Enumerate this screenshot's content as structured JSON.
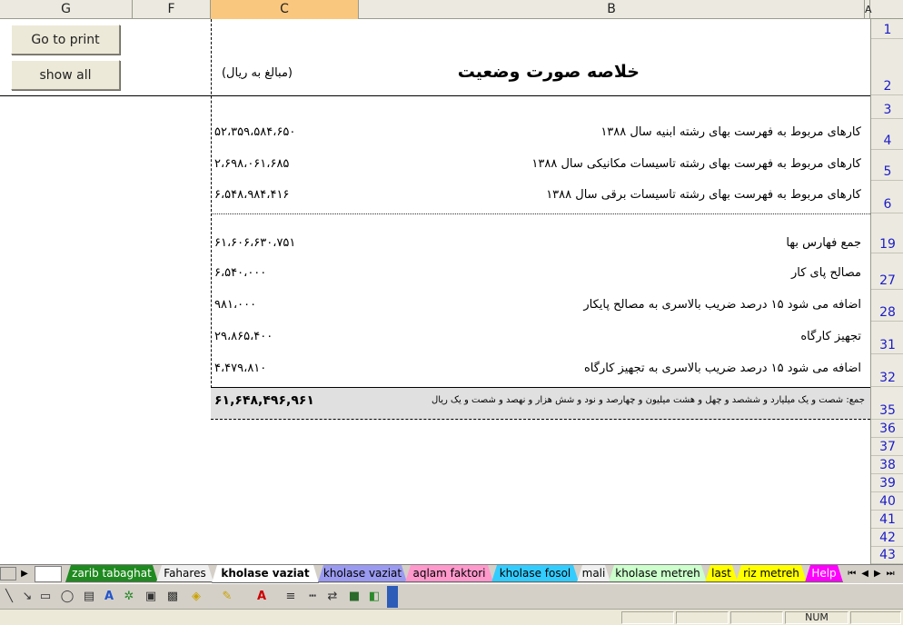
{
  "columns": {
    "g": "G",
    "f": "F",
    "c": "C",
    "b": "B",
    "a": "A"
  },
  "rows": [
    "1",
    "2",
    "3",
    "4",
    "5",
    "6",
    "19",
    "27",
    "28",
    "31",
    "32",
    "35",
    "36",
    "37",
    "38",
    "39",
    "40",
    "41",
    "42",
    "43"
  ],
  "buttons": {
    "print": "Go to print",
    "show_all": "show all"
  },
  "sheet": {
    "title": "خلاصه صورت وضعیت",
    "unit_note": "(مبالغ به ریال)",
    "items": [
      {
        "label": "کارهای مربوط به فهرست بهای رشته ابنیه سال ۱۳۸۸",
        "value": "۵۲،۳۵۹،۵۸۴،۶۵۰"
      },
      {
        "label": "کارهای مربوط به فهرست بهای رشته تاسیسات مکانیکی سال ۱۳۸۸",
        "value": "۲،۶۹۸،۰۶۱،۶۸۵"
      },
      {
        "label": "کارهای مربوط به فهرست بهای رشته تاسیسات برقی سال ۱۳۸۸",
        "value": "۶،۵۴۸،۹۸۴،۴۱۶"
      }
    ],
    "summary": [
      {
        "label": "جمع فهارس بها",
        "value": "۶۱،۶۰۶،۶۳۰،۷۵۱"
      },
      {
        "label": "مصالح پای کار",
        "value": "۶،۵۴۰،۰۰۰"
      },
      {
        "label": "اضافه می شود ۱۵ درصد ضریب بالاسری به مصالح پایکار",
        "value": "۹۸۱،۰۰۰"
      },
      {
        "label": "تجهیز کارگاه",
        "value": "۲۹،۸۶۵،۴۰۰"
      },
      {
        "label": "اضافه می شود ۱۵ درصد ضریب بالاسری به تجهیز کارگاه",
        "value": "۴،۴۷۹،۸۱۰"
      }
    ],
    "total": {
      "label": "جمع: شصت و یک میلیارد و ششصد و چهل و هشت میلیون و چهارصد و نود و شش هزار و نهصد و شصت و یک ریال",
      "value": "۶۱,۶۴۸,۴۹۶,۹۶۱"
    }
  },
  "tabs": [
    {
      "label": "zarib tabaghat",
      "color": "#1f8a1f"
    },
    {
      "label": "Fahares",
      "color": "#ffffff"
    },
    {
      "label": "kholase vaziat kol",
      "color": "#ffffff"
    },
    {
      "label": "kholase vaziat",
      "color": "#9a9af0"
    },
    {
      "label": "aqlam faktori",
      "color": "#ff99cc"
    },
    {
      "label": "kholase fosol",
      "color": "#33ccff"
    },
    {
      "label": "mali",
      "color": "#ffffff"
    },
    {
      "label": "kholase metreh",
      "color": "#ccffcc"
    },
    {
      "label": "last",
      "color": "#ffff00"
    },
    {
      "label": "riz metreh",
      "color": "#ffff00"
    },
    {
      "label": "Help",
      "color": "#ff00ff"
    }
  ],
  "status": {
    "num": "NUM"
  },
  "icons": [
    "line-icon",
    "arrow-icon",
    "rectangle-icon",
    "oval-icon",
    "textbox-icon",
    "wordart-icon",
    "diagram-icon",
    "clipart-icon",
    "picture-icon",
    "fill-color-icon",
    "line-color-icon",
    "font-color-icon",
    "line-style-icon",
    "dash-style-icon",
    "arrow-style-icon",
    "shadow-icon",
    "3d-icon"
  ]
}
